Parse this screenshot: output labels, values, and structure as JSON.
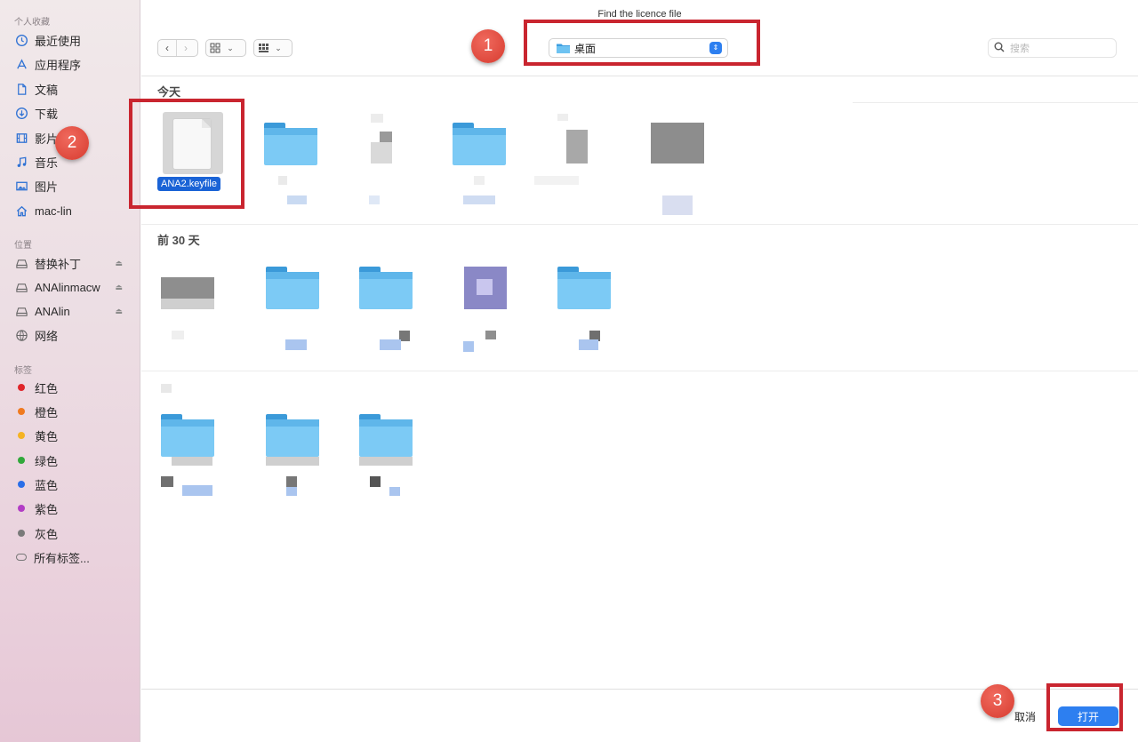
{
  "window": {
    "title": "Find the licence file"
  },
  "sidebar": {
    "favorites_header": "个人收藏",
    "favorites": [
      {
        "label": "最近使用",
        "icon": "clock-icon"
      },
      {
        "label": "应用程序",
        "icon": "applications-icon"
      },
      {
        "label": "文稿",
        "icon": "document-icon"
      },
      {
        "label": "下载",
        "icon": "download-icon"
      },
      {
        "label": "影片",
        "icon": "film-icon"
      },
      {
        "label": "音乐",
        "icon": "music-note-icon"
      },
      {
        "label": "图片",
        "icon": "photo-icon"
      },
      {
        "label": "mac-lin",
        "icon": "home-icon"
      }
    ],
    "locations_header": "位置",
    "locations": [
      {
        "label": "替换补丁",
        "icon": "disk-icon",
        "eject": true
      },
      {
        "label": "ANAlinmacw",
        "icon": "disk-icon",
        "eject": true
      },
      {
        "label": "ANAlin",
        "icon": "disk-icon",
        "eject": true
      },
      {
        "label": "网络",
        "icon": "network-globe-icon",
        "eject": false
      }
    ],
    "tags_header": "标签",
    "tags": [
      {
        "label": "红色",
        "color": "#e0262b"
      },
      {
        "label": "橙色",
        "color": "#f07a1f"
      },
      {
        "label": "黄色",
        "color": "#f5b323"
      },
      {
        "label": "绿色",
        "color": "#31a83b"
      },
      {
        "label": "蓝色",
        "color": "#2a6ee8"
      },
      {
        "label": "紫色",
        "color": "#b23dc5"
      },
      {
        "label": "灰色",
        "color": "#7a7a7a"
      }
    ],
    "all_tags_label": "所有标签..."
  },
  "toolbar": {
    "back_glyph": "‹",
    "forward_glyph": "›",
    "location_label": "桌面",
    "search_placeholder": "搜索"
  },
  "groups": {
    "today_header": "今天",
    "last30_header": "前 30 天",
    "selected_file_name": "ANA2.keyfile"
  },
  "footer": {
    "cancel_label": "取消",
    "open_label": "打开"
  },
  "annotations": {
    "step1": "1",
    "step2": "2",
    "step3": "3"
  },
  "colors": {
    "accent": "#2d7ff0",
    "selection": "#1a63d6",
    "annotation_red": "#c9252f",
    "folder_blue": "#7ccaf5"
  }
}
